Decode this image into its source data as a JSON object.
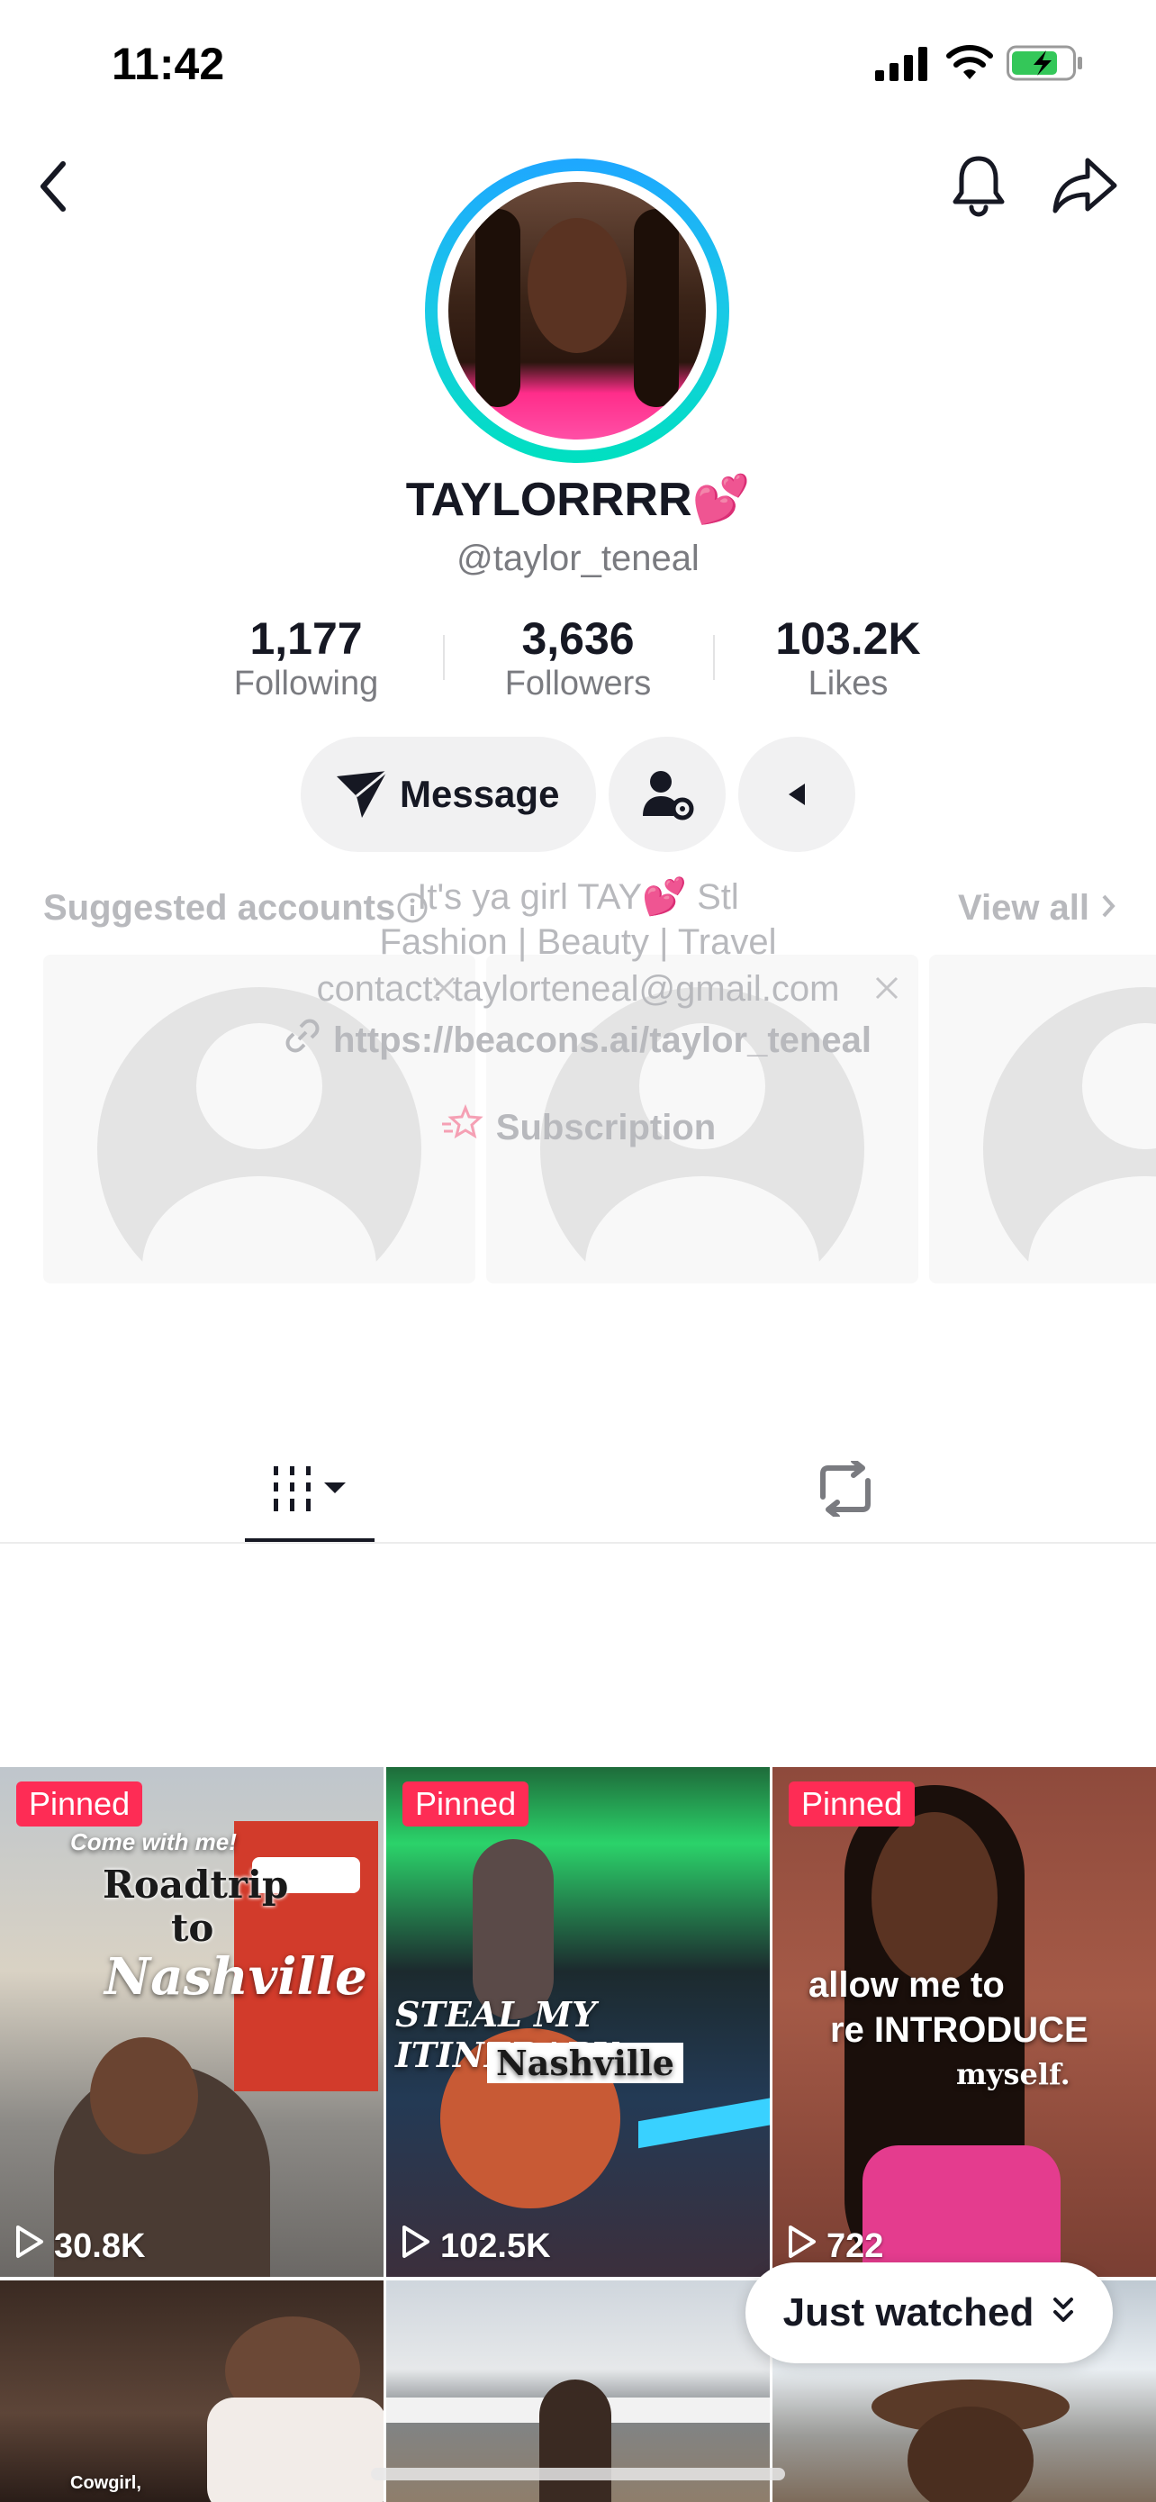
{
  "status": {
    "time": "11:42"
  },
  "profile": {
    "display_name": "TAYLORRRR💕",
    "username": "@taylor_teneal",
    "stats": [
      {
        "value": "1,177",
        "label": "Following"
      },
      {
        "value": "3,636",
        "label": "Followers"
      },
      {
        "value": "103.2K",
        "label": "Likes"
      }
    ],
    "message_label": "Message"
  },
  "bio": {
    "line1": "It's ya girl TAY💕 Stl",
    "line2": "Fashion | Beauty | Travel",
    "line3": "contact: taylorteneal@gmail.com",
    "link": "https://beacons.ai/taylor_teneal",
    "subscription": "Subscription"
  },
  "suggested": {
    "title": "Suggested accounts",
    "view_all": "View all"
  },
  "videos": [
    {
      "badge": "Pinned",
      "views": "30.8K",
      "caption_lines": [
        "Come with me!",
        "Roadtrip",
        "to",
        "Nashville"
      ]
    },
    {
      "badge": "Pinned",
      "views": "102.5K",
      "caption_lines": [
        "STEAL MY ITINERARY",
        "Nashville"
      ]
    },
    {
      "badge": "Pinned",
      "views": "722",
      "caption_lines": [
        "allow me to",
        "re INTRODUCE",
        "myself."
      ]
    },
    {
      "caption_lines": [
        "Cowgirl,"
      ]
    }
  ],
  "just_watched": "Just watched"
}
